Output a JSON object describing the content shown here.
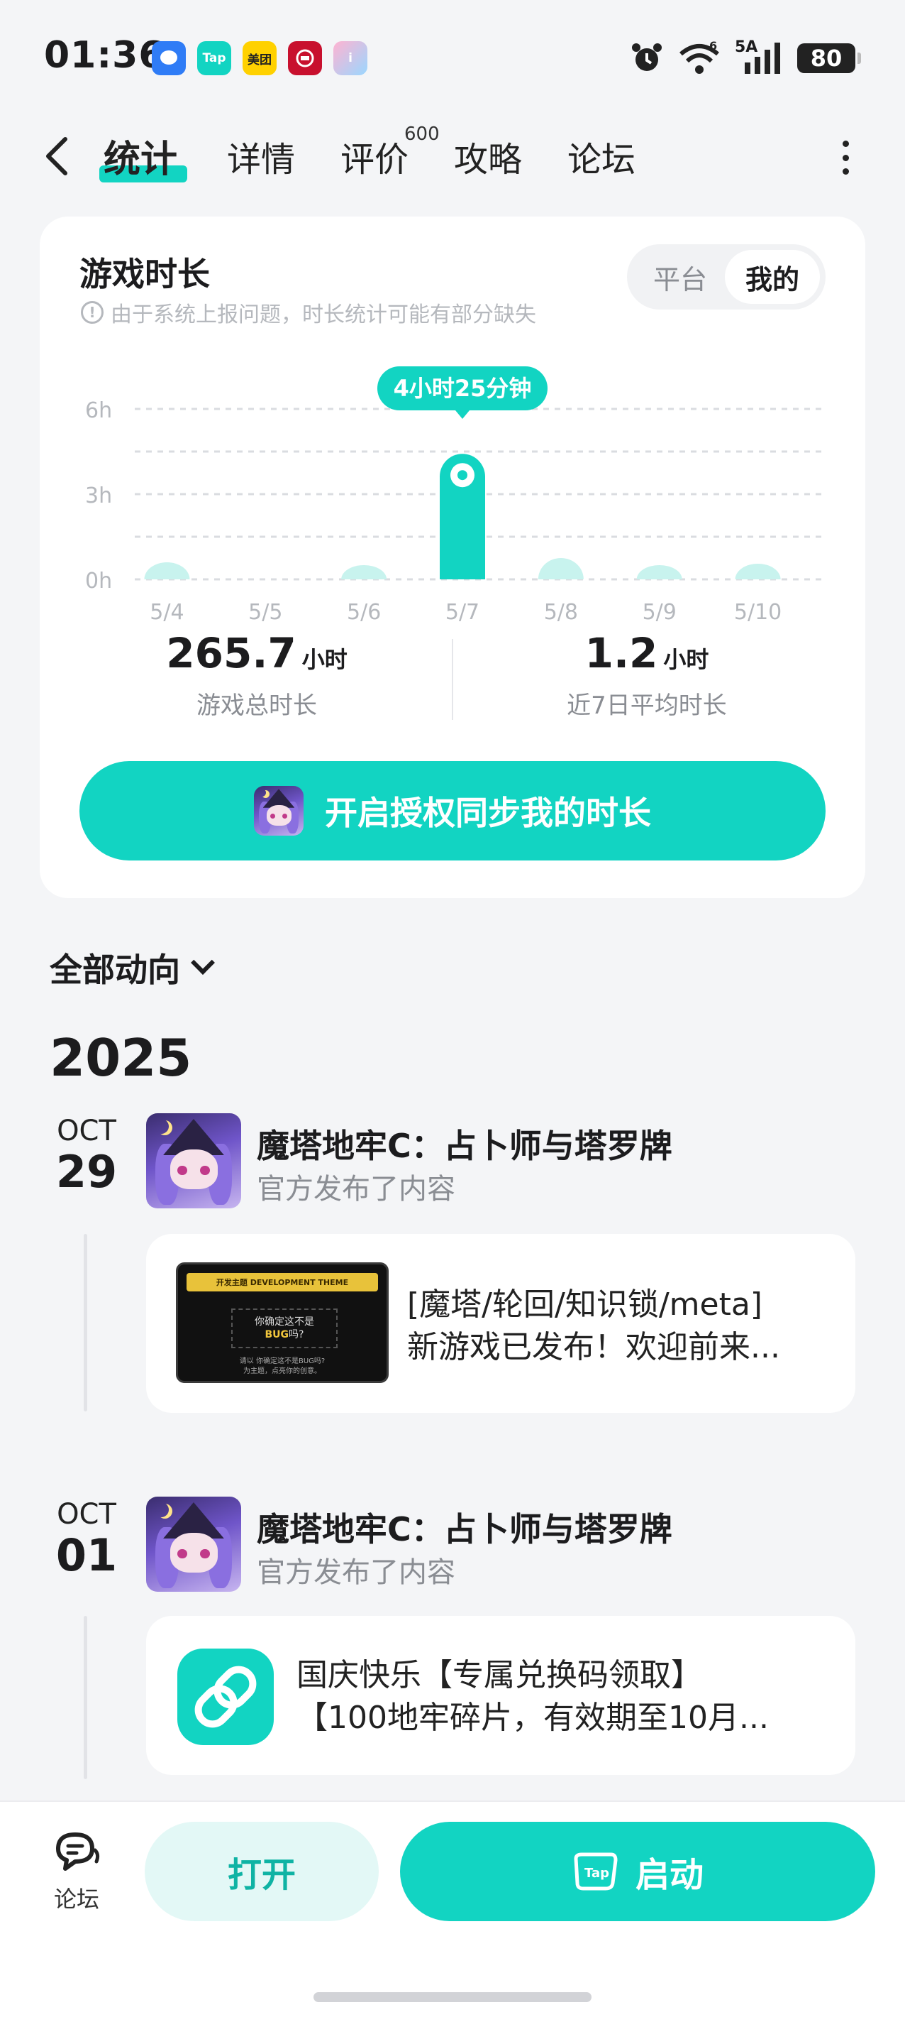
{
  "status_bar": {
    "time": "01:36",
    "apps": [
      {
        "icon": "message-app-icon",
        "label": "",
        "color": "#2f7cf6"
      },
      {
        "icon": "taptap-app-icon",
        "label": "Tap",
        "color": "#12d4c2"
      },
      {
        "icon": "meituan-app-icon",
        "label": "美团",
        "color": "#ffd100"
      },
      {
        "icon": "bank-app-icon",
        "label": "",
        "color": "#c8102e"
      },
      {
        "icon": "i-app-icon",
        "label": "i",
        "color": "#ff6fa0"
      }
    ],
    "network": "5A",
    "battery": "80"
  },
  "nav": {
    "tabs": [
      "统计",
      "详情",
      "评价",
      "攻略",
      "论坛"
    ],
    "active_tab": "统计",
    "review_badge": "600"
  },
  "playtime_card": {
    "title": "游戏时长",
    "note": "由于系统上报问题，时长统计可能有部分缺失",
    "toggle": {
      "options": [
        "平台",
        "我的"
      ],
      "selected": "我的"
    },
    "total_value": "265.7",
    "total_unit": "小时",
    "total_label": "游戏总时长",
    "avg_value": "1.2",
    "avg_unit": "小时",
    "avg_label": "近7日平均时长",
    "auth_button": "开启授权同步我的时长"
  },
  "chart_data": {
    "type": "bar",
    "categories": [
      "5/4",
      "5/5",
      "5/6",
      "5/7",
      "5/8",
      "5/9",
      "5/10"
    ],
    "values": [
      0.6,
      0,
      0.3,
      4.42,
      0.75,
      0.3,
      0.55
    ],
    "y_ticks": [
      "6h",
      "3h",
      "0h"
    ],
    "ylim": [
      0,
      6
    ],
    "highlight_index": 3,
    "highlight_label": "4小时25分钟",
    "colors": {
      "bar": "#c8f3ee",
      "highlight": "#12d4c2"
    },
    "grid": true
  },
  "feed": {
    "header": "全部动向",
    "year": "2025",
    "items": [
      {
        "month": "OCT",
        "day": "29",
        "title": "魔塔地牢C：占卜师与塔罗牌",
        "subtitle": "官方发布了内容",
        "post_line1": "[魔塔/轮回/知识锁/meta]",
        "post_line2": "新游戏已发布！欢迎前来...",
        "thumb_bar": "开发主题 DEVELOPMENT THEME",
        "thumb_q1": "你确定这不是",
        "thumb_q2": "BUG",
        "thumb_q3": "吗?",
        "thumb_foot1": "请以 你确定这不是BUG吗? ",
        "thumb_foot2": "为主题，点亮你的创意。"
      },
      {
        "month": "OCT",
        "day": "01",
        "title": "魔塔地牢C：占卜师与塔罗牌",
        "subtitle": "官方发布了内容",
        "post_line1": "国庆快乐【专属兑换码领取】",
        "post_line2": "【100地牢碎片，有效期至10月..."
      }
    ]
  },
  "bottom_bar": {
    "forum_label": "论坛",
    "open_button": "打开",
    "start_button": "启动",
    "start_icon_label": "Tap"
  }
}
